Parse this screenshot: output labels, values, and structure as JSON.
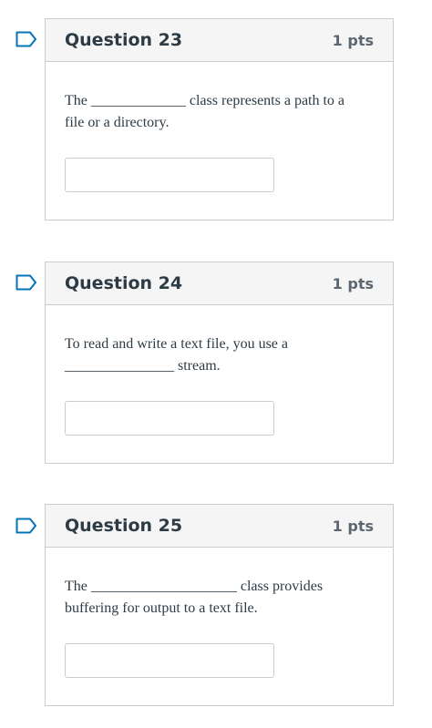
{
  "questions": [
    {
      "title": "Question 23",
      "points": "1 pts",
      "text": "The _____________ class represents a path to a file or a directory.",
      "answer_value": ""
    },
    {
      "title": "Question 24",
      "points": "1 pts",
      "text": "To read and write a text file, you use a _______________ stream.",
      "answer_value": ""
    },
    {
      "title": "Question 25",
      "points": "1 pts",
      "text": "The ____________________ class provides buffering for output to a text file.",
      "answer_value": ""
    }
  ],
  "colors": {
    "border": "#c7cdd1",
    "header_bg": "#f5f5f5",
    "flag": "#0374b5",
    "title_text": "#2d3b45"
  },
  "icons": {
    "flag": "flag-bookmark-icon"
  }
}
